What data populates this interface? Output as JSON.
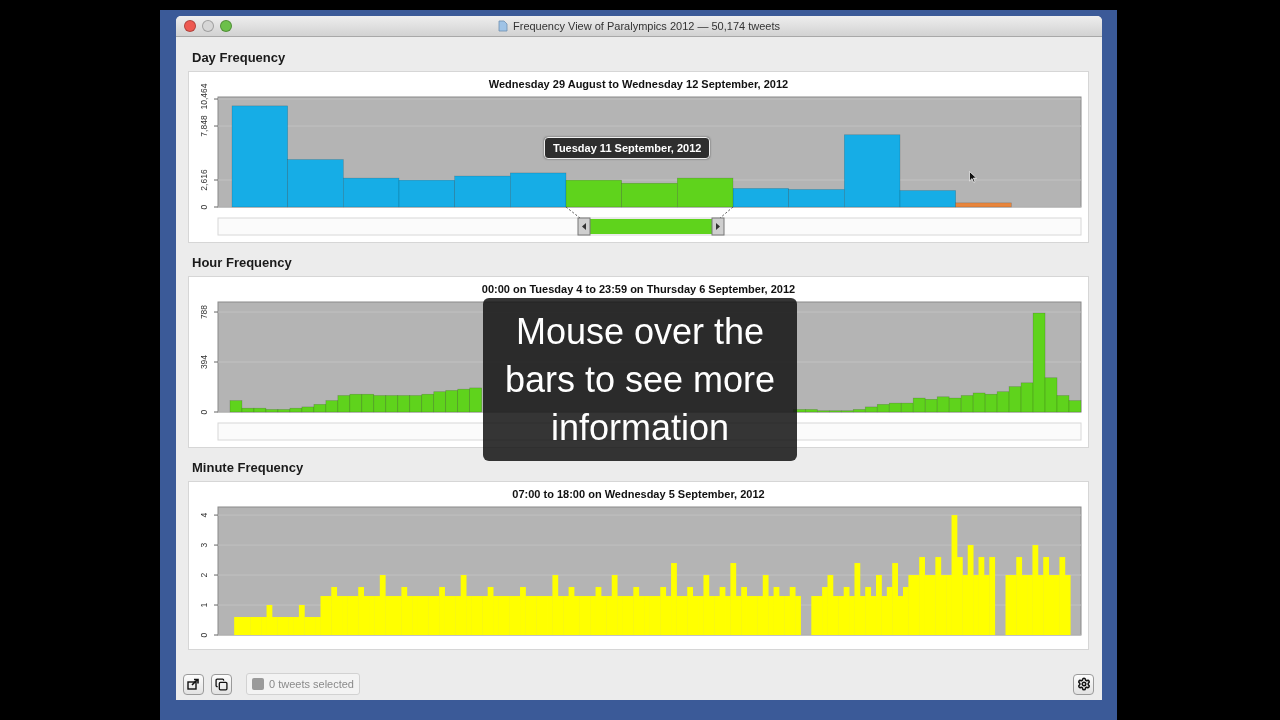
{
  "window": {
    "title": "Frequency View of Paralympics 2012 — 50,174 tweets"
  },
  "sections": [
    {
      "heading": "Day Frequency",
      "kind": "ranged",
      "chart_title": "Wednesday 29 August to Wednesday 12 September, 2012",
      "tooltip": "Tuesday 11 September, 2012",
      "chart_data": {
        "type": "bar",
        "grid": true,
        "ylim": [
          0,
          10660
        ],
        "yticks": [
          {
            "value": 0,
            "label": "0"
          },
          {
            "value": 2616,
            "label": "2,616"
          },
          {
            "value": 7848,
            "label": "7,848"
          },
          {
            "value": 10464,
            "label": "10,464"
          }
        ],
        "series": [
          {
            "color": "#16ade6",
            "values": [
              9800,
              4600,
              2800,
              2600,
              3000,
              3300,
              null,
              null,
              null,
              1800,
              1700,
              7000,
              1600,
              null,
              null
            ]
          },
          {
            "color": "#5fd31c",
            "values": [
              null,
              null,
              null,
              null,
              null,
              null,
              2600,
              2300,
              2800,
              null,
              null,
              null,
              null,
              null,
              null
            ]
          },
          {
            "color": "#e8853c",
            "values": [
              null,
              null,
              null,
              null,
              null,
              null,
              null,
              null,
              null,
              null,
              null,
              null,
              null,
              400,
              null
            ]
          }
        ]
      }
    },
    {
      "heading": "Hour Frequency",
      "kind": "ranged",
      "chart_title": "00:00 on Tuesday 4 to 23:59 on Thursday 6 September, 2012",
      "chart_data": {
        "type": "bar",
        "grid": true,
        "ylim": [
          0,
          867
        ],
        "yticks": [
          {
            "value": 0,
            "label": "0"
          },
          {
            "value": 394,
            "label": "394"
          },
          {
            "value": 788,
            "label": "788"
          }
        ],
        "series": [
          {
            "color": "#5fd31c",
            "values": [
              0,
              90,
              30,
              30,
              20,
              20,
              30,
              40,
              60,
              90,
              130,
              140,
              140,
              130,
              130,
              130,
              130,
              140,
              160,
              170,
              180,
              190,
              null,
              null,
              null,
              null,
              null,
              null,
              null,
              null,
              null,
              null,
              null,
              null,
              null,
              null,
              null,
              null,
              null,
              null,
              null,
              null,
              null,
              null,
              null,
              null,
              null,
              null,
              20,
              20,
              10,
              10,
              10,
              20,
              40,
              60,
              70,
              70,
              110,
              100,
              120,
              110,
              130,
              150,
              140,
              160,
              200,
              230,
              780,
              270,
              130,
              90
            ]
          }
        ]
      }
    },
    {
      "heading": "Minute Frequency",
      "kind": "plain",
      "chart_title": "07:00 to 18:00 on Wednesday 5 September, 2012",
      "chart_data": {
        "type": "bar",
        "grid": true,
        "ylim": [
          0,
          4.27
        ],
        "yticks": [
          {
            "value": 0,
            "label": "0"
          },
          {
            "value": 1,
            "label": "1"
          },
          {
            "value": 2,
            "label": "2"
          },
          {
            "value": 3,
            "label": "3"
          },
          {
            "value": 4,
            "label": "4"
          }
        ],
        "series": [
          {
            "color": "#ffff00",
            "values": [
              0,
              0,
              0,
              0.6,
              0.6,
              0.6,
              0.6,
              0.6,
              0.6,
              1,
              0.6,
              0.6,
              0.6,
              0.6,
              0.6,
              1,
              0.6,
              0.6,
              0.6,
              1.3,
              1.3,
              1.6,
              1.3,
              1.3,
              1.3,
              1.3,
              1.6,
              1.3,
              1.3,
              1.3,
              2,
              1.3,
              1.3,
              1.3,
              1.6,
              1.3,
              1.3,
              1.3,
              1.3,
              1.3,
              1.3,
              1.6,
              1.3,
              1.3,
              1.3,
              2,
              1.3,
              1.3,
              1.3,
              1.3,
              1.6,
              1.3,
              1.3,
              1.3,
              1.3,
              1.3,
              1.6,
              1.3,
              1.3,
              1.3,
              1.3,
              1.3,
              2,
              1.3,
              1.3,
              1.6,
              1.3,
              1.3,
              1.3,
              1.3,
              1.6,
              1.3,
              1.3,
              2,
              1.3,
              1.3,
              1.3,
              1.6,
              1.3,
              1.3,
              1.3,
              1.3,
              1.6,
              1.3,
              2.4,
              1.3,
              1.3,
              1.6,
              1.3,
              1.3,
              2,
              1.3,
              1.3,
              1.6,
              1.3,
              2.4,
              1.3,
              1.6,
              1.3,
              1.3,
              1.3,
              2,
              1.3,
              1.6,
              1.3,
              1.3,
              1.6,
              1.3,
              0,
              0,
              1.3,
              1.3,
              1.6,
              2,
              1.3,
              1.3,
              1.6,
              1.3,
              2.4,
              1.3,
              1.6,
              1.3,
              2,
              1.3,
              1.6,
              2.4,
              1.3,
              1.6,
              2,
              2,
              2.6,
              2,
              2,
              2.6,
              2,
              2,
              4,
              2.6,
              2,
              3,
              2,
              2.6,
              2,
              2.6,
              0,
              0,
              2,
              2,
              2.6,
              2,
              2,
              3,
              2,
              2.6,
              2,
              2,
              2.6,
              2,
              0,
              0
            ]
          }
        ]
      }
    }
  ],
  "overlay_caption": "Mouse over the bars to see more information",
  "status_bar": {
    "selection": "0 tweets selected"
  }
}
